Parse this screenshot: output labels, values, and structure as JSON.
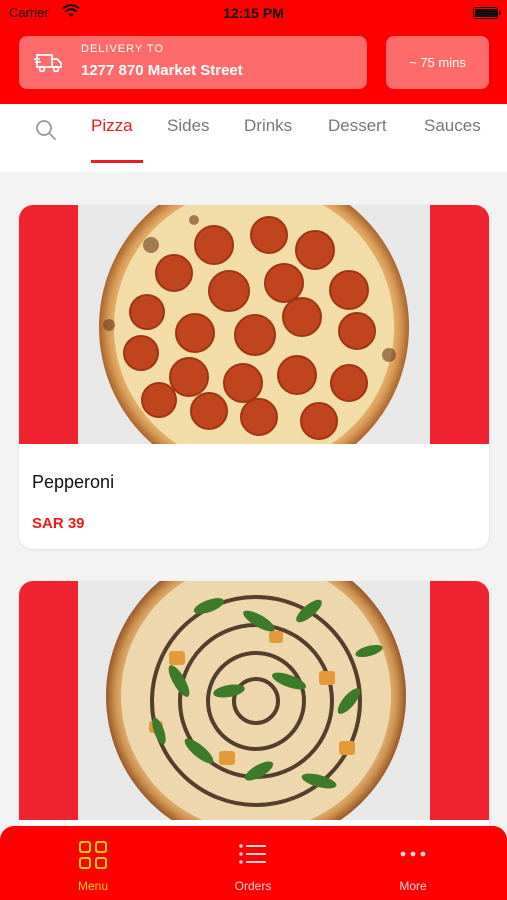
{
  "status": {
    "carrier": "Carrier",
    "time": "12:15 PM"
  },
  "header": {
    "delivery_label": "DELIVERY TO",
    "delivery_address": "1277 870 Market Street",
    "eta": "~ 75 mins"
  },
  "tabs": [
    {
      "label": "Pizza",
      "active": true
    },
    {
      "label": "Sides"
    },
    {
      "label": "Drinks"
    },
    {
      "label": "Dessert"
    },
    {
      "label": "Sauces"
    }
  ],
  "products": [
    {
      "name": "Pepperoni",
      "price": "SAR 39"
    },
    {
      "name": "",
      "price": ""
    }
  ],
  "bottom_nav": [
    {
      "label": "Menu",
      "icon": "grid-icon",
      "active": true
    },
    {
      "label": "Orders",
      "icon": "list-icon"
    },
    {
      "label": "More",
      "icon": "more-dots-icon"
    }
  ],
  "colors": {
    "brand": "#ff0000",
    "accent": "#ee1b1b",
    "active_nav": "#ffd200"
  }
}
